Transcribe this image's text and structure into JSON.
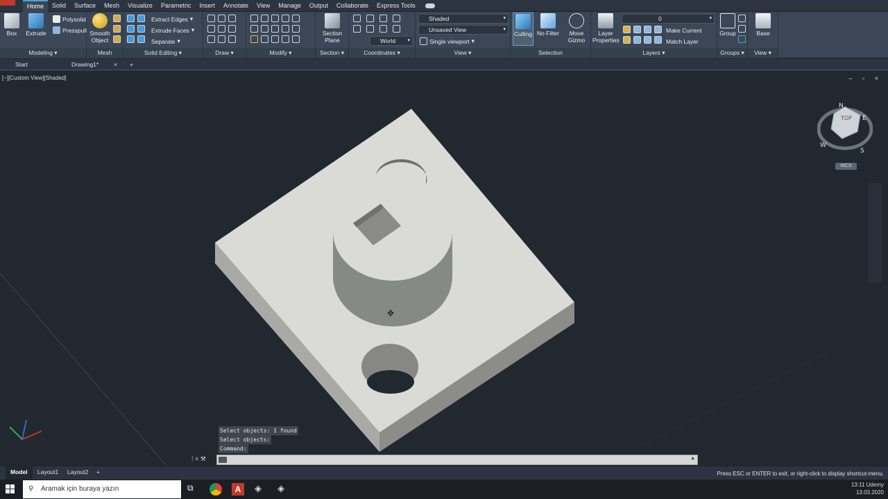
{
  "menu": {
    "tabs": [
      "Home",
      "Solid",
      "Surface",
      "Mesh",
      "Visualize",
      "Parametric",
      "Insert",
      "Annotate",
      "View",
      "Manage",
      "Output",
      "Collaborate",
      "Express Tools"
    ],
    "active": "Home"
  },
  "ribbon": {
    "modeling": {
      "title": "Modeling",
      "box": "Box",
      "extrude": "Extrude",
      "polysolid": "Polysolid",
      "presspull": "Presspull"
    },
    "mesh": {
      "title": "Mesh",
      "smooth": "Smooth Object"
    },
    "solid_editing": {
      "title": "Solid Editing",
      "extract_edges": "Extract Edges",
      "extrude_faces": "Extrude Faces",
      "separate": "Separate"
    },
    "draw": {
      "title": "Draw"
    },
    "modify": {
      "title": "Modify"
    },
    "section": {
      "title": "Section",
      "section_plane": "Section Plane"
    },
    "coordinates": {
      "title": "Coordinates",
      "world": "World"
    },
    "view": {
      "title": "View",
      "visual_style": "Shaded",
      "named_view": "Unsaved View",
      "viewport": "Single viewport"
    },
    "selection": {
      "title": "Selection",
      "culling": "Culling",
      "no_filter": "No Filter",
      "move_gizmo": "Move Gizmo"
    },
    "layers": {
      "title": "Layers",
      "layer_properties": "Layer Properties",
      "layer_value": "0",
      "make_current": "Make Current",
      "match_layer": "Match Layer"
    },
    "groups": {
      "title": "Groups",
      "group": "Group"
    },
    "viewpanel": {
      "title": "View",
      "base": "Base"
    }
  },
  "file_tabs": {
    "start": "Start",
    "drawing": "Drawing1*",
    "close": "×",
    "add": "+"
  },
  "viewport": {
    "label": "[−][Custom View][Shaded]",
    "viewcube": {
      "face": "TOP",
      "n": "N",
      "e": "E",
      "s": "S",
      "w": "W"
    },
    "wcs": "WCS",
    "window_controls": "– ▫ ×"
  },
  "command": {
    "history": [
      "Select objects: 1 found",
      "Select objects:",
      "Command:"
    ],
    "input_value": ""
  },
  "layout_tabs": {
    "tabs": [
      "Model",
      "Layout1",
      "Layout2"
    ],
    "add": "+"
  },
  "status": {
    "hint": "Press ESC or ENTER to exit, or right-click to display shortcut-menu."
  },
  "taskbar": {
    "search_placeholder": "Aramak için buraya yazın",
    "time": "13:11",
    "date": "13.03.2020",
    "tray_text": "Udemy"
  },
  "colors": {
    "ribbon_bg": "#3b4756",
    "viewport_bg": "#212830",
    "model_face": "#dadbd6",
    "accent": "#4aa3df"
  }
}
